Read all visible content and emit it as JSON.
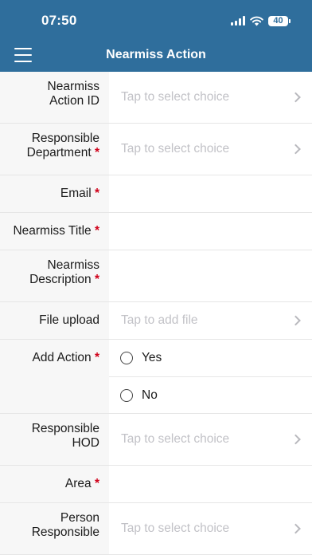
{
  "status_bar": {
    "time": "07:50",
    "battery": "40"
  },
  "header": {
    "title": "Nearmiss Action"
  },
  "form": {
    "nearmiss_action_id": {
      "label_line1": "Nearmiss",
      "label_line2": "Action ID",
      "placeholder": "Tap to select choice"
    },
    "responsible_department": {
      "label_line1": "Responsible",
      "label_line2": "Department",
      "required_mark": "*",
      "placeholder": "Tap to select choice"
    },
    "email": {
      "label": "Email",
      "required_mark": "*"
    },
    "nearmiss_title": {
      "label": "Nearmiss Title",
      "required_mark": "*"
    },
    "nearmiss_description": {
      "label_line1": "Nearmiss",
      "label_line2": "Description",
      "required_mark": "*"
    },
    "file_upload": {
      "label": "File upload",
      "placeholder": "Tap to add file"
    },
    "add_action": {
      "label": "Add Action",
      "required_mark": "*",
      "options": [
        "Yes",
        "No"
      ]
    },
    "responsible_hod": {
      "label_line1": "Responsible",
      "label_line2": "HOD",
      "placeholder": "Tap to select choice"
    },
    "area": {
      "label": "Area",
      "required_mark": "*"
    },
    "person_responsible": {
      "label_line1": "Person",
      "label_line2": "Responsible",
      "placeholder": "Tap to select choice"
    }
  }
}
